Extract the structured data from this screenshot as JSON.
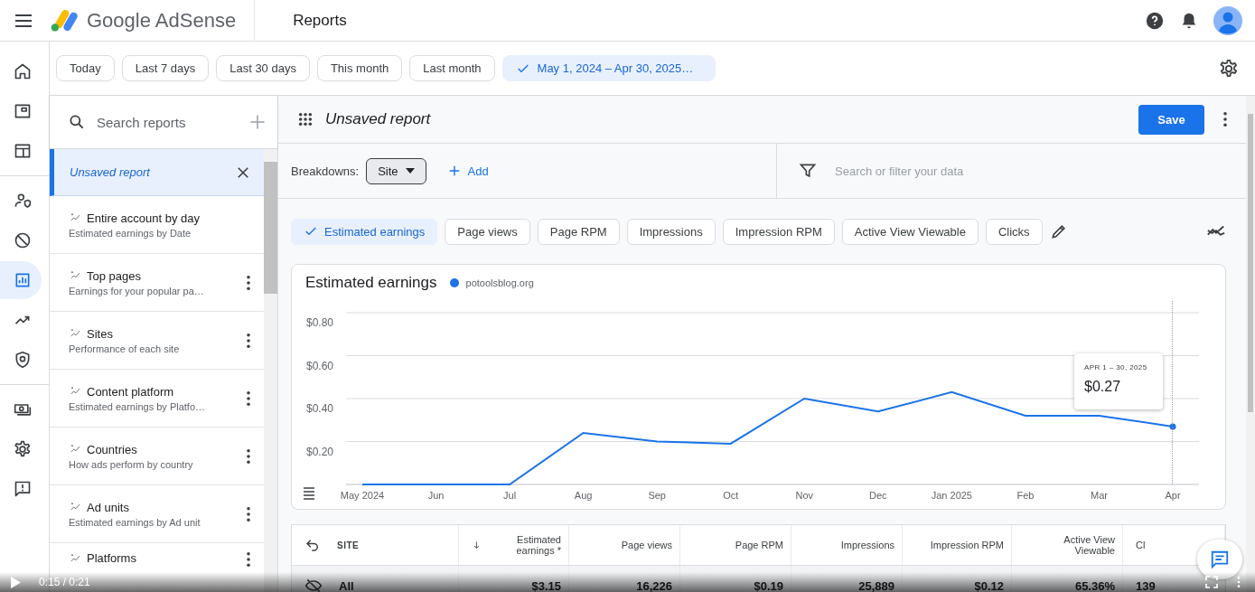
{
  "header": {
    "product": "Google AdSense",
    "page_title": "Reports"
  },
  "date_ranges": [
    {
      "label": "Today",
      "selected": false
    },
    {
      "label": "Last 7 days",
      "selected": false
    },
    {
      "label": "Last 30 days",
      "selected": false
    },
    {
      "label": "This month",
      "selected": false
    },
    {
      "label": "Last month",
      "selected": false
    },
    {
      "label": "May 1, 2024 – Apr 30, 2025…",
      "selected": true
    }
  ],
  "nav_rail": [
    {
      "kind": "home",
      "selected": false
    },
    {
      "kind": "window",
      "selected": false
    },
    {
      "kind": "layout",
      "selected": false
    },
    {
      "kind": "person",
      "selected": false
    },
    {
      "kind": "block",
      "selected": false
    },
    {
      "kind": "chart",
      "selected": true
    },
    {
      "kind": "trend",
      "selected": false
    },
    {
      "kind": "shield",
      "selected": false
    },
    {
      "kind": "cash",
      "selected": false
    },
    {
      "kind": "gear",
      "selected": false
    },
    {
      "kind": "feedback",
      "selected": false
    }
  ],
  "report_list": {
    "search_placeholder": "Search reports",
    "items": [
      {
        "title": "Unsaved report",
        "selected": true
      },
      {
        "title": "Entire account by day",
        "subtitle": "Estimated earnings by Date",
        "selected": false
      },
      {
        "title": "Top pages",
        "subtitle": "Earnings for your popular pa…",
        "selected": false
      },
      {
        "title": "Sites",
        "subtitle": "Performance of each site",
        "selected": false
      },
      {
        "title": "Content platform",
        "subtitle": "Estimated earnings by Platfo…",
        "selected": false
      },
      {
        "title": "Countries",
        "subtitle": "How ads perform by country",
        "selected": false
      },
      {
        "title": "Ad units",
        "subtitle": "Estimated earnings by Ad unit",
        "selected": false
      },
      {
        "title": "Platforms",
        "selected": false
      }
    ]
  },
  "report": {
    "title": "Unsaved report",
    "save": "Save",
    "breakdowns_label": "Breakdowns:",
    "breakdown": "Site",
    "add": "Add",
    "filter_placeholder": "Search or filter your data"
  },
  "metrics": [
    {
      "label": "Estimated earnings",
      "selected": true
    },
    {
      "label": "Page views",
      "selected": false
    },
    {
      "label": "Page RPM",
      "selected": false
    },
    {
      "label": "Impressions",
      "selected": false
    },
    {
      "label": "Impression RPM",
      "selected": false
    },
    {
      "label": "Active View Viewable",
      "selected": false
    },
    {
      "label": "Clicks",
      "selected": false
    }
  ],
  "chart": {
    "title": "Estimated earnings",
    "tooltip": {
      "date": "APR 1 – 30, 2025",
      "value": "$0.27"
    },
    "chart_data": {
      "type": "line",
      "categories": [
        "May 2024",
        "Jun",
        "Jul",
        "Aug",
        "Sep",
        "Oct",
        "Nov",
        "Dec",
        "Jan 2025",
        "Feb",
        "Mar",
        "Apr"
      ],
      "series": [
        {
          "name": "potoolsblog.org",
          "color": "#1a73e8",
          "values": [
            0,
            0,
            0,
            0.24,
            0.2,
            0.19,
            0.4,
            0.34,
            0.43,
            0.32,
            0.32,
            0.27
          ]
        }
      ],
      "ylim": [
        0,
        0.8
      ],
      "grid": true,
      "yticks": [
        {
          "value": 0.2,
          "label": "$0.20"
        },
        {
          "value": 0.4,
          "label": "$0.40"
        },
        {
          "value": 0.6,
          "label": "$0.60"
        },
        {
          "value": 0.8,
          "label": "$0.80"
        }
      ]
    }
  },
  "table": {
    "columns": [
      "SITE",
      "Estimated earnings *",
      "Page views",
      "Page RPM",
      "Impressions",
      "Impression RPM",
      "Active View Viewable",
      "Cl"
    ],
    "rows": [
      {
        "cells": [
          "All",
          "$3.15",
          "16,226",
          "$0.19",
          "25,889",
          "$0.12",
          "65.36%",
          "139"
        ]
      }
    ]
  },
  "video": {
    "time": "0:15 / 0:21"
  }
}
